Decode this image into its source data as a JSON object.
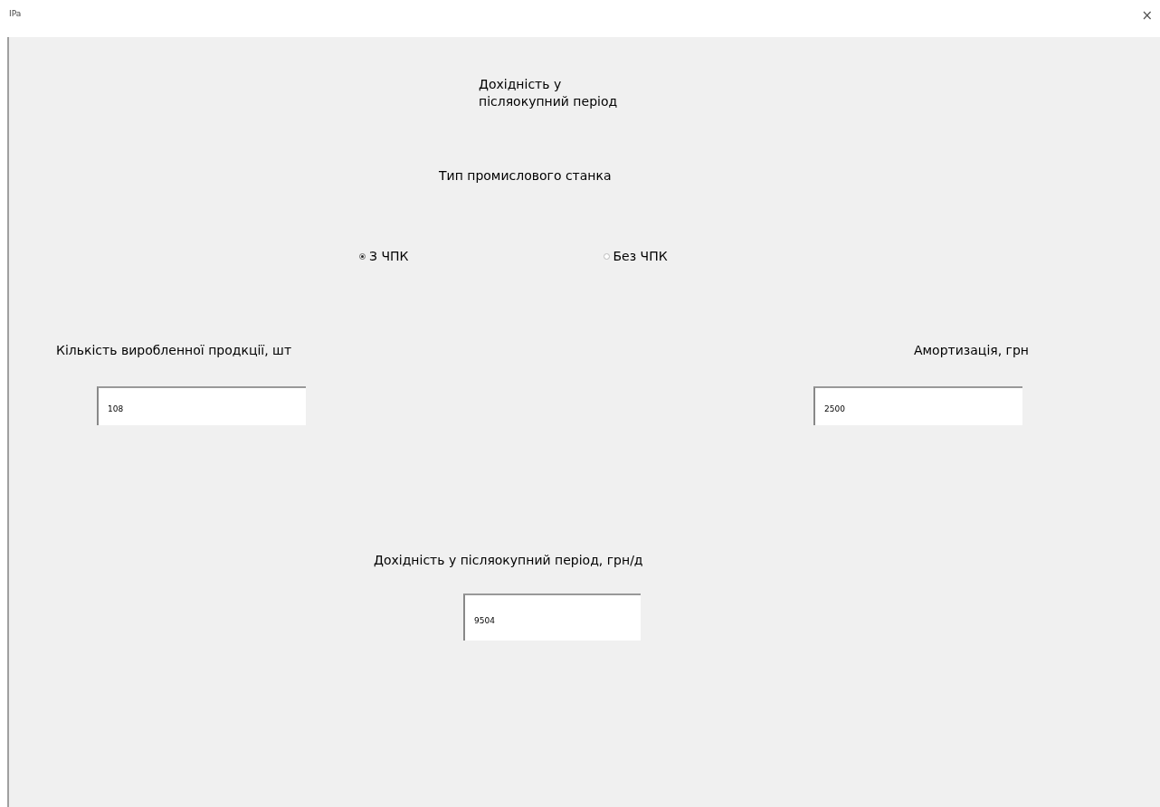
{
  "window": {
    "title": "IPa",
    "close": "×"
  },
  "heading": "Дохідність у\nпісляокупний період",
  "group_label": "Тип промислового станка",
  "radios": [
    {
      "label": "З ЧПК",
      "selected": true
    },
    {
      "label": "Без ЧПК",
      "selected": false
    }
  ],
  "fields": [
    {
      "label": "Кількість виробленної продкції, шт",
      "value": "108"
    },
    {
      "label": "Амортизація, грн",
      "value": "2500"
    }
  ],
  "result": {
    "label": "Дохідність у післяокупний період, грн/д",
    "value": "9504"
  }
}
